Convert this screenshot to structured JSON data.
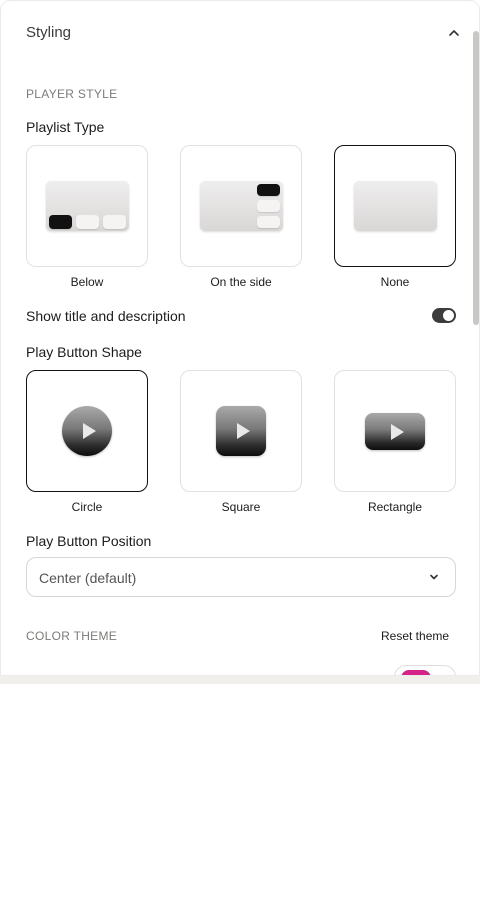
{
  "header": {
    "title": "Styling"
  },
  "player_style": {
    "section_label": "PLAYER STYLE",
    "playlist_type": {
      "title": "Playlist Type",
      "options": [
        {
          "label": "Below",
          "selected": false
        },
        {
          "label": "On the side",
          "selected": false
        },
        {
          "label": "None",
          "selected": true
        }
      ]
    },
    "show_title": {
      "label": "Show title and description",
      "enabled": true
    },
    "play_button_shape": {
      "title": "Play Button Shape",
      "options": [
        {
          "label": "Circle",
          "selected": true
        },
        {
          "label": "Square",
          "selected": false
        },
        {
          "label": "Rectangle",
          "selected": false
        }
      ]
    },
    "play_button_position": {
      "title": "Play Button Position",
      "value": "Center (default)"
    }
  },
  "color_theme": {
    "section_label": "COLOR THEME",
    "reset_label": "Reset theme",
    "swatch_color": "#d4248a"
  },
  "colors": {
    "selected_border": "#111111",
    "toggle_on": "#3c3c3c"
  }
}
